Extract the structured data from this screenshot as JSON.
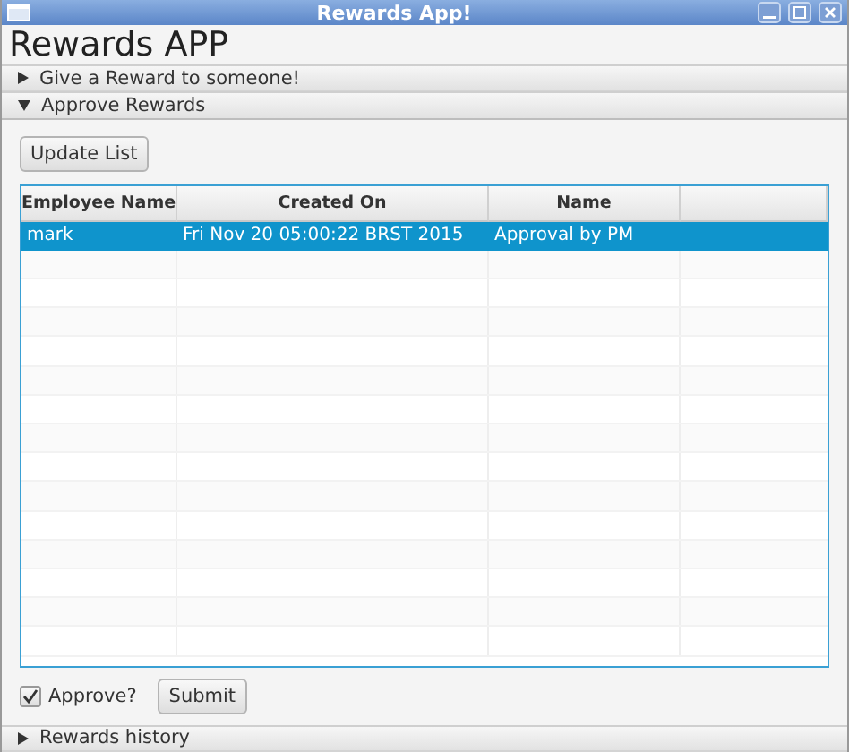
{
  "window": {
    "title": "Rewards App!"
  },
  "heading": "Rewards APP",
  "panes": [
    {
      "title": "Give a Reward to someone!",
      "expanded": false
    },
    {
      "title": "Approve Rewards",
      "expanded": true,
      "update_button": "Update List",
      "table": {
        "columns": [
          "Employee Name",
          "Created On",
          "Name",
          ""
        ],
        "rows": [
          {
            "cells": [
              "mark",
              "Fri Nov 20 05:00:22 BRST 2015",
              "Approval by PM",
              ""
            ],
            "selected": true
          }
        ]
      },
      "approve": {
        "label": "Approve?",
        "checked": true
      },
      "submit_button": "Submit"
    },
    {
      "title": "Rewards history",
      "expanded": false
    }
  ]
}
